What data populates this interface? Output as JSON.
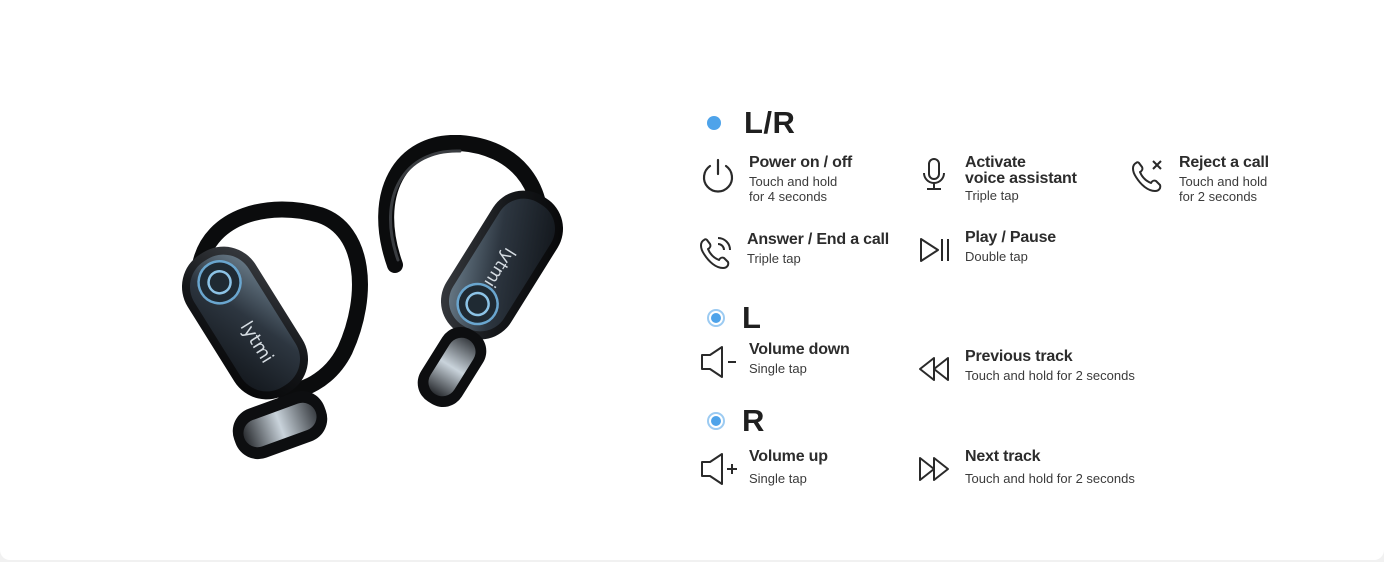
{
  "sections": {
    "lr": {
      "title": "L/R",
      "items": [
        {
          "title": "Power on / off",
          "desc1": "Touch and hold",
          "desc2": "for 4 seconds",
          "icon": "power-icon"
        },
        {
          "title": "Activate",
          "title2": "voice assistant",
          "desc1": "Triple tap",
          "icon": "microphone-icon"
        },
        {
          "title": "Reject a call",
          "desc1": "Touch and hold",
          "desc2": "for 2 seconds",
          "icon": "phone-reject-icon"
        },
        {
          "title": "Answer / End a call",
          "desc1": "Triple tap",
          "icon": "phone-answer-icon"
        },
        {
          "title": "Play / Pause",
          "desc1": "Double tap",
          "icon": "play-pause-icon"
        }
      ]
    },
    "l": {
      "title": "L",
      "items": [
        {
          "title": "Volume down",
          "desc1": "Single tap",
          "icon": "volume-down-icon"
        },
        {
          "title": "Previous track",
          "desc1": "Touch and hold for 2 seconds",
          "icon": "previous-track-icon"
        }
      ]
    },
    "r": {
      "title": "R",
      "items": [
        {
          "title": "Volume up",
          "desc1": "Single tap",
          "icon": "volume-up-icon"
        },
        {
          "title": "Next track",
          "desc1": "Touch and hold for 2 seconds",
          "icon": "next-track-icon"
        }
      ]
    }
  },
  "product": {
    "brand_text": "lytmi",
    "icon": "earbuds-image"
  },
  "colors": {
    "accent": "#4ea3ea",
    "accent_light": "#9ccbf2",
    "text": "#2c2c2c"
  }
}
